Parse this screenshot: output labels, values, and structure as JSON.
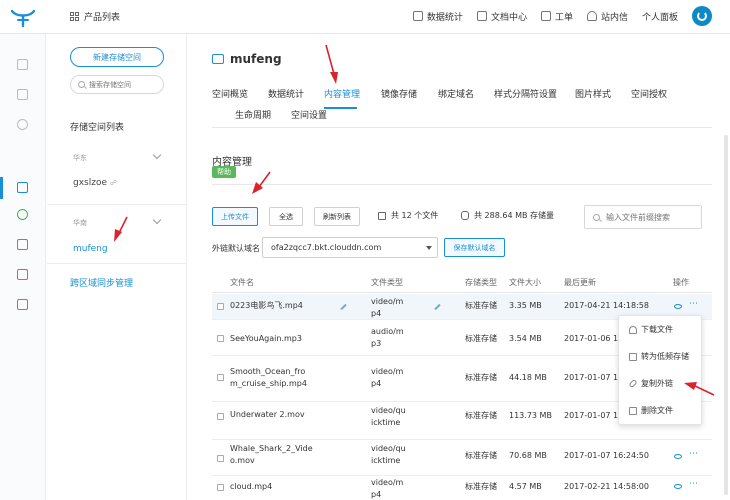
{
  "header": {
    "product_list": "产品列表",
    "nav": [
      "数据统计",
      "文档中心",
      "工单",
      "站内信",
      "个人面板"
    ]
  },
  "sidebar": {
    "new_bucket": "新建存储空间",
    "search_placeholder": "搜索存储空间",
    "list_title": "存储空间列表",
    "groups": [
      {
        "region": "华东",
        "buckets": [
          "gxslzoe"
        ]
      },
      {
        "region": "华南",
        "buckets": [
          "mufeng"
        ]
      }
    ],
    "sync_link": "跨区域同步管理"
  },
  "bucket": {
    "name": "mufeng",
    "tabs": [
      "空间概览",
      "数据统计",
      "内容管理",
      "镜像存储",
      "绑定域名",
      "样式分隔符设置",
      "图片样式",
      "空间授权",
      "生命周期",
      "空间设置"
    ],
    "active_tab": "内容管理"
  },
  "content": {
    "title": "内容管理",
    "help": "帮助",
    "buttons": {
      "upload": "上传文件",
      "select_all": "全选",
      "refresh": "刷新列表"
    },
    "file_count": "共 12 个文件",
    "storage": "共 288.64 MB 存储量",
    "search_placeholder": "输入文件前缀搜索",
    "domain_label": "外链默认域名",
    "domain_value": "ofa2zqcc7.bkt.clouddn.com",
    "save_domain": "保存默认域名"
  },
  "table": {
    "headers": [
      "文件名",
      "文件类型",
      "存储类型",
      "文件大小",
      "最后更新",
      "操作"
    ],
    "rows": [
      {
        "name": "0223电影鸟飞.mp4",
        "type": "video/mp4",
        "storage": "标准存储",
        "size": "3.35 MB",
        "updated": "2017-04-21 14:18:58"
      },
      {
        "name": "SeeYouAgain.mp3",
        "type": "audio/mp3",
        "storage": "标准存储",
        "size": "3.54 MB",
        "updated": "2017-01-06 16:1"
      },
      {
        "name": "Smooth_Ocean_from_cruise_ship.mp4",
        "type": "video/mp4",
        "storage": "标准存储",
        "size": "44.18 MB",
        "updated": "2017-01-07 16:2"
      },
      {
        "name": "Underwater 2.mov",
        "type": "video/quicktime",
        "storage": "标准存储",
        "size": "113.73 MB",
        "updated": "2017-01-07 16:2"
      },
      {
        "name": "Whale_Shark_2_Video.mov",
        "type": "video/quicktime",
        "storage": "标准存储",
        "size": "70.68 MB",
        "updated": "2017-01-07 16:24:50"
      },
      {
        "name": "cloud.mp4",
        "type": "video/mp4",
        "storage": "标准存储",
        "size": "4.57 MB",
        "updated": "2017-02-21 14:58:00"
      }
    ]
  },
  "menu": {
    "items": [
      "下载文件",
      "转为低频存储",
      "复制外链",
      "删除文件"
    ]
  },
  "colors": {
    "accent": "#1a8ed6",
    "help_badge": "#5cb85c",
    "annotation": "#d9232e"
  }
}
